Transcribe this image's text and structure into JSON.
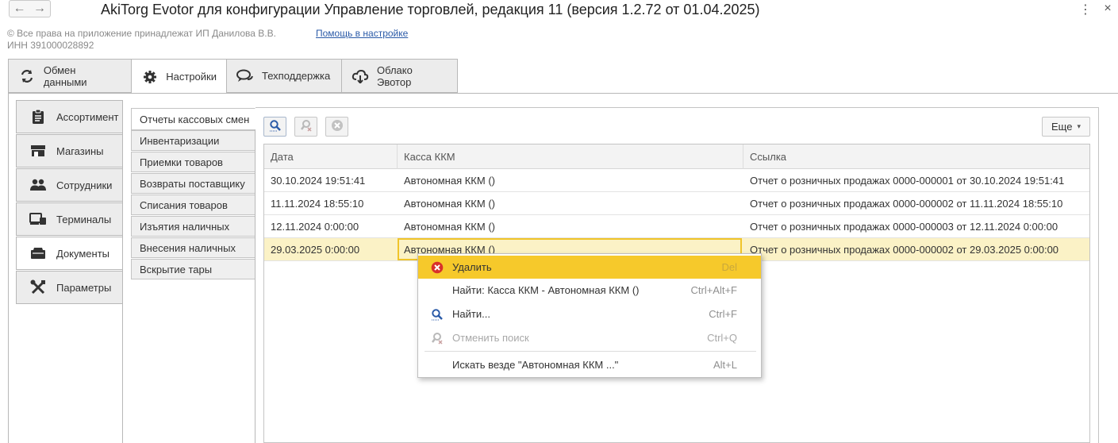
{
  "window": {
    "title": "AkiTorg Evotor для конфигурации Управление торговлей, редакция 11 (версия 1.2.72 от 01.04.2025)",
    "back_icon": "←",
    "forward_icon": "→",
    "more_icon": "⋮",
    "close_icon": "×"
  },
  "header": {
    "copyright": "© Все права на приложение принадлежат ИП Данилова В.В.",
    "inn": "ИНН 391000028892",
    "help_link": "Помощь в настройке"
  },
  "top_tabs": [
    {
      "label": "Обмен данными",
      "icon": "sync-icon"
    },
    {
      "label": "Настройки",
      "icon": "gear-icon"
    },
    {
      "label": "Техподдержка",
      "icon": "chat-icon"
    },
    {
      "label": "Облако Эвотор",
      "icon": "cloud-icon"
    }
  ],
  "active_top_tab": "Настройки",
  "side_tabs": [
    {
      "label": "Ассортимент",
      "icon": "clipboard-icon"
    },
    {
      "label": "Магазины",
      "icon": "store-icon"
    },
    {
      "label": "Сотрудники",
      "icon": "people-icon"
    },
    {
      "label": "Терминалы",
      "icon": "terminal-icon"
    },
    {
      "label": "Документы",
      "icon": "folder-icon"
    },
    {
      "label": "Параметры",
      "icon": "tools-icon"
    }
  ],
  "active_side_tab": "Документы",
  "doc_types": [
    "Отчеты кассовых смен",
    "Инвентаризации",
    "Приемки товаров",
    "Возвраты поставщику",
    "Списания товаров",
    "Изъятия наличных",
    "Внесения наличных",
    "Вскрытие тары"
  ],
  "active_doc_type": "Отчеты кассовых смен",
  "toolbar": {
    "find_icon": "search-icon",
    "cancel_find_icon": "search-cancel-icon",
    "clear_icon": "clear-icon",
    "more_label": "Еще",
    "more_caret": "▾"
  },
  "table": {
    "columns": [
      "Дата",
      "Касса ККМ",
      "Ссылка"
    ],
    "rows": [
      [
        "30.10.2024 19:51:41",
        "Автономная ККМ ()",
        "Отчет о розничных продажах 0000-000001 от 30.10.2024 19:51:41"
      ],
      [
        "11.11.2024 18:55:10",
        "Автономная ККМ ()",
        "Отчет о розничных продажах 0000-000002 от 11.11.2024 18:55:10"
      ],
      [
        "12.11.2024 0:00:00",
        "Автономная ККМ ()",
        "Отчет о розничных продажах 0000-000003 от 12.11.2024 0:00:00"
      ],
      [
        "29.03.2025 0:00:00",
        "Автономная ККМ ()",
        "Отчет о розничных продажах 0000-000002 от 29.03.2025 0:00:00"
      ]
    ],
    "selected_row": 3
  },
  "context_menu": {
    "items": [
      {
        "label": "Удалить",
        "shortcut": "Del",
        "icon": "delete-icon",
        "highlighted": true,
        "disabled": false
      },
      {
        "label": "Найти: Касса ККМ - Автономная ККМ ()",
        "shortcut": "Ctrl+Alt+F",
        "icon": "",
        "highlighted": false,
        "disabled": false
      },
      {
        "label": "Найти...",
        "shortcut": "Ctrl+F",
        "icon": "search-icon",
        "highlighted": false,
        "disabled": false
      },
      {
        "label": "Отменить поиск",
        "shortcut": "Ctrl+Q",
        "icon": "search-cancel-icon",
        "highlighted": false,
        "disabled": true
      },
      {
        "label": "Искать везде \"Автономная ККМ ...\"",
        "shortcut": "Alt+L",
        "icon": "",
        "highlighted": false,
        "disabled": false
      }
    ]
  },
  "colors": {
    "accent": "#f6c92b",
    "selected_row": "#fbf2c6",
    "link": "#2b5ba8",
    "delete_icon": "#d9312a"
  }
}
